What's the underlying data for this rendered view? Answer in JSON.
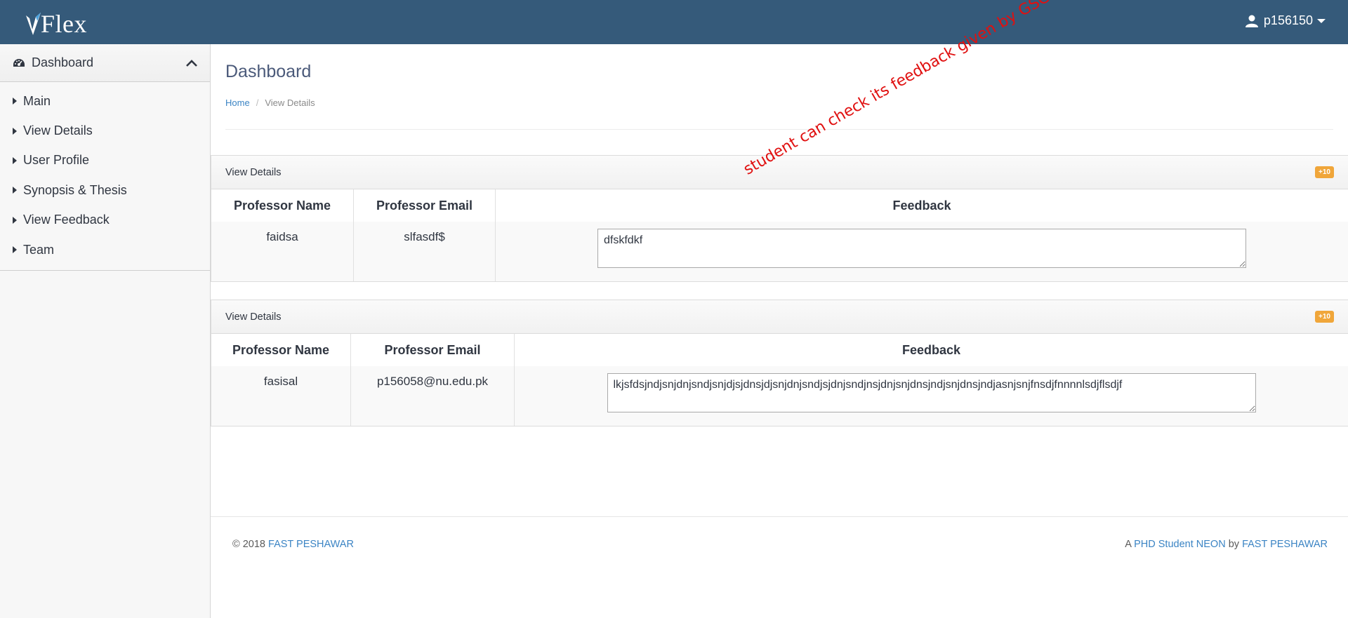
{
  "header": {
    "logo_text": "Flex",
    "username": "p156150"
  },
  "sidebar": {
    "section_label": "Dashboard",
    "items": [
      {
        "label": "Main"
      },
      {
        "label": "View Details"
      },
      {
        "label": "User Profile"
      },
      {
        "label": "Synopsis & Thesis"
      },
      {
        "label": "View Feedback"
      },
      {
        "label": "Team"
      }
    ]
  },
  "main": {
    "title": "Dashboard",
    "breadcrumb": {
      "home": "Home",
      "separator": "/",
      "current": "View Details"
    },
    "annotation": "student can check its feedback given by GSC",
    "panels": [
      {
        "title": "View Details",
        "badge": "+10",
        "columns": [
          "Professor Name",
          "Professor Email",
          "Feedback"
        ],
        "row": {
          "name": "faidsa",
          "email": "slfasdf$",
          "feedback": "dfskfdkf"
        }
      },
      {
        "title": "View Details",
        "badge": "+10",
        "columns": [
          "Professor Name",
          "Professor Email",
          "Feedback"
        ],
        "row": {
          "name": "fasisal",
          "email": "p156058@nu.edu.pk",
          "feedback": "lkjsfdsjndjsnjdnjsndjsnjdjsjdnsjdjsnjdnjsndjsjdnjsndjnsjdnjsnjdnsjndjsnjdnsjndjasnjsnjfnsdjfnnnnlsdjflsdjf"
        }
      }
    ]
  },
  "footer": {
    "copyright": "© 2018",
    "org_link": "FAST PESHAWAR",
    "right_prefix": "A",
    "product_link": "PHD Student NEON",
    "by_text": "by",
    "org_link_2": "FAST PESHAWAR"
  },
  "colors": {
    "topbar": "#355a7a",
    "link": "#3b84c4",
    "badge": "#f0a63a",
    "annotation": "#e01010"
  }
}
